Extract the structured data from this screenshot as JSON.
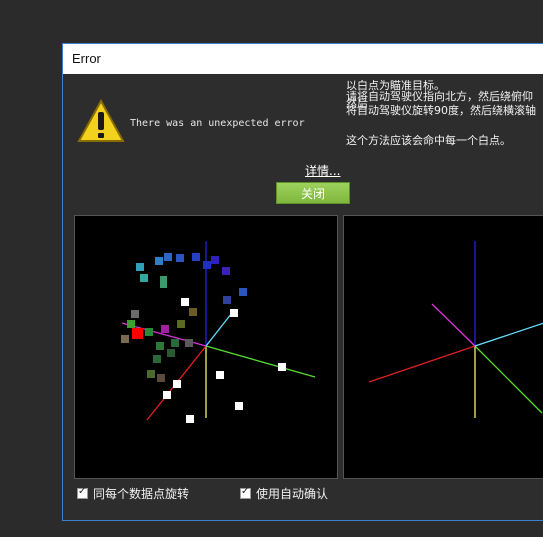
{
  "window": {
    "title": "Error"
  },
  "error": {
    "message": "There was an unexpected error"
  },
  "info_lines": {
    "l1": "以白点为瞄准目标。",
    "l2": "请将自动驾驶仪指向北方，然后绕俯仰",
    "l3": "然后",
    "l4": "将自动驾驶仪旋转90度，然后绕横滚轴",
    "l5": "这个方法应该会命中每一个白点。"
  },
  "buttons": {
    "details_label": "详情...",
    "close_label": "关闭"
  },
  "checkboxes": {
    "rotate_each": {
      "label": "同每个数据点旋转",
      "checked": true
    },
    "auto_confirm": {
      "label": "使用自动确认",
      "checked": true
    }
  },
  "colors": {
    "accent_border": "#3d7fd1",
    "close_button": "#8cc24a",
    "selected_point": "#ff0000",
    "target_point": "#ffffff"
  },
  "icons": {
    "warning": "warning-triangle-icon",
    "checkbox": "checkmark-icon"
  }
}
